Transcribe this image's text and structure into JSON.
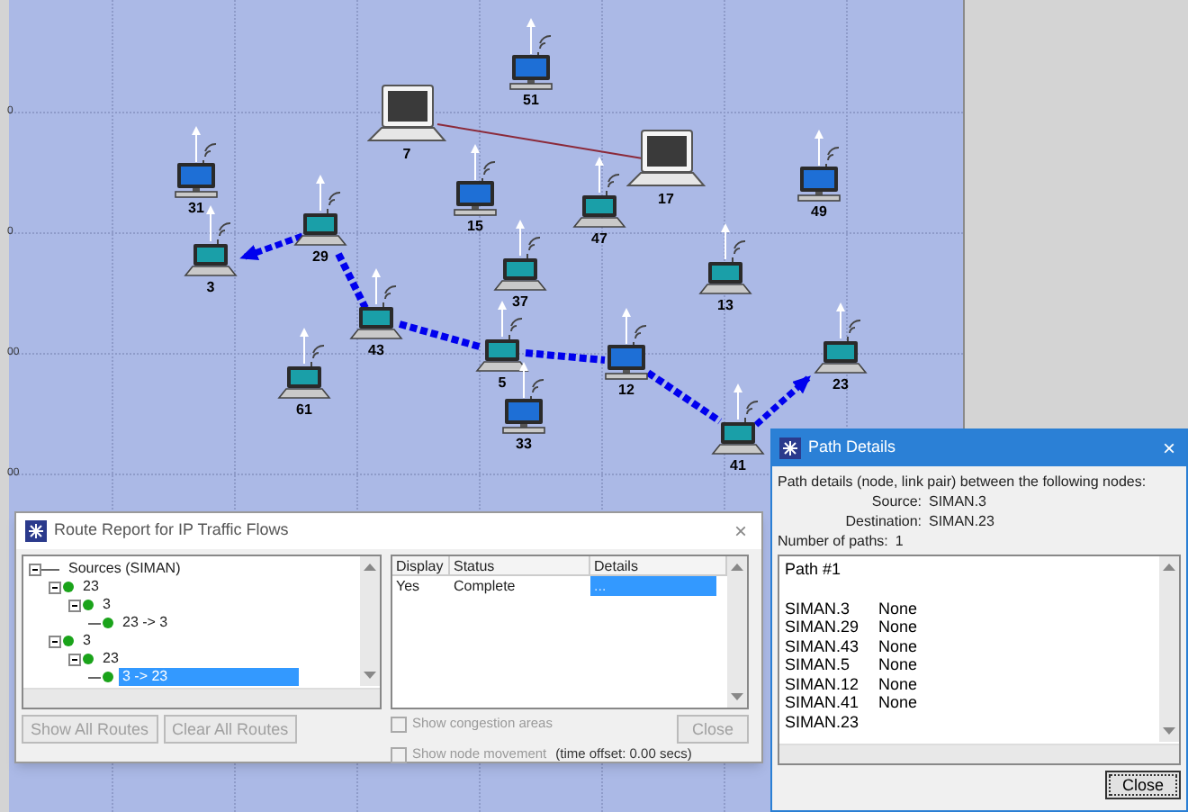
{
  "canvas": {
    "y_axis_labels": [
      "0",
      "0",
      "00",
      "00"
    ],
    "nodes": [
      {
        "label": "51",
        "kind": "desktop"
      },
      {
        "label": "7",
        "kind": "notebook"
      },
      {
        "label": "17",
        "kind": "notebook"
      },
      {
        "label": "31",
        "kind": "desktop"
      },
      {
        "label": "15",
        "kind": "desktop"
      },
      {
        "label": "47",
        "kind": "laptop"
      },
      {
        "label": "49",
        "kind": "desktop"
      },
      {
        "label": "3",
        "kind": "laptop"
      },
      {
        "label": "29",
        "kind": "laptop"
      },
      {
        "label": "37",
        "kind": "laptop"
      },
      {
        "label": "13",
        "kind": "laptop"
      },
      {
        "label": "43",
        "kind": "laptop"
      },
      {
        "label": "5",
        "kind": "laptop"
      },
      {
        "label": "12",
        "kind": "desktop"
      },
      {
        "label": "23",
        "kind": "laptop"
      },
      {
        "label": "61",
        "kind": "laptop"
      },
      {
        "label": "33",
        "kind": "desktop"
      },
      {
        "label": "41",
        "kind": "laptop"
      }
    ]
  },
  "route_report": {
    "title": "Route Report for IP Traffic Flows",
    "close": "×",
    "tree": {
      "label": "Sources (SIMAN)",
      "expanded": true,
      "selected": false,
      "children": [
        {
          "label": "23",
          "expanded": true,
          "selected": false,
          "children": [
            {
              "label": "3",
              "expanded": true,
              "selected": false,
              "children": [
                {
                  "label": "23 -> 3",
                  "selected": false
                }
              ]
            }
          ]
        },
        {
          "label": "3",
          "expanded": true,
          "selected": false,
          "children": [
            {
              "label": "23",
              "expanded": true,
              "selected": false,
              "children": [
                {
                  "label": "3 -> 23",
                  "selected": true
                }
              ]
            }
          ]
        }
      ]
    },
    "table": {
      "columns": [
        "Display",
        "Status",
        "Details"
      ],
      "rows": [
        [
          {
            "text": "Yes",
            "selected": false
          },
          {
            "text": "Complete",
            "selected": false
          },
          {
            "text": "...",
            "selected": true
          }
        ]
      ]
    },
    "buttons": [
      {
        "label": "Show All Routes",
        "disabled": true
      },
      {
        "label": "Clear All Routes",
        "disabled": true
      }
    ],
    "options": [
      {
        "label": "Show congestion areas",
        "checked": false,
        "disabled": true
      },
      {
        "label": "Show node movement",
        "note": "(time offset: 0.00 secs)",
        "checked": false,
        "disabled": true
      }
    ],
    "close_button": {
      "label": "Close",
      "disabled": true
    }
  },
  "path_details": {
    "title": "Path Details",
    "close": "×",
    "intro": "Path details (node, link pair) between the following nodes:",
    "fields": [
      {
        "label": "Source:",
        "value": "SIMAN.3"
      },
      {
        "label": "Destination:",
        "value": "SIMAN.23"
      }
    ],
    "count": {
      "label": "Number of paths:",
      "value": "1"
    },
    "heading": "Path #1",
    "hops": [
      {
        "node": "SIMAN.3",
        "link": "None"
      },
      {
        "node": "SIMAN.29",
        "link": "None"
      },
      {
        "node": "SIMAN.43",
        "link": "None"
      },
      {
        "node": "SIMAN.5",
        "link": "None"
      },
      {
        "node": "SIMAN.12",
        "link": "None"
      },
      {
        "node": "SIMAN.41",
        "link": "None"
      },
      {
        "node": "SIMAN.23"
      }
    ],
    "close_button": {
      "label": "Close",
      "disabled": false
    }
  }
}
